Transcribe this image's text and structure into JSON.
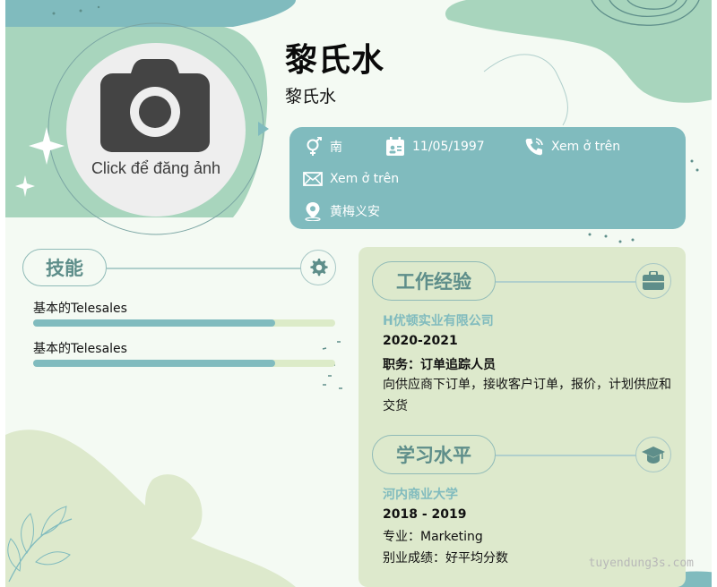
{
  "profile": {
    "name": "黎氏水",
    "subtitle": "黎氏水",
    "photo_label": "Click để đăng ảnh"
  },
  "contact": {
    "gender": "南",
    "birthday": "11/05/1997",
    "phone": "Xem ở trên",
    "email": "Xem ở trên",
    "address": "黄梅义安",
    "icons": [
      "gender-icon",
      "calendar-icon",
      "phone-icon",
      "mail-icon",
      "location-icon"
    ]
  },
  "skills": {
    "title": "技能",
    "items": [
      {
        "label": "基本的Telesales",
        "level": 0.8
      },
      {
        "label": "基本的Telesales",
        "level": 0.8
      }
    ]
  },
  "experience": {
    "title": "工作经验",
    "company": "H优顿实业有限公司",
    "years": "2020-2021",
    "role": "职务：订单追踪人员",
    "desc_line1": "向供应商下订单，接收客户订单，报价，计划供应和",
    "desc_line2": "交货"
  },
  "education": {
    "title": "学习水平",
    "school": "河内商业大学",
    "years": "2018 - 2019",
    "major": "专业：Marketing",
    "grade": "别业成绩：好平均分数"
  },
  "watermark": "tuyendung3s.com",
  "colors": {
    "teal": "#80bbbe",
    "mint": "#a8d5bd",
    "sage": "#dde9cc",
    "label": "#5e8e8a"
  }
}
